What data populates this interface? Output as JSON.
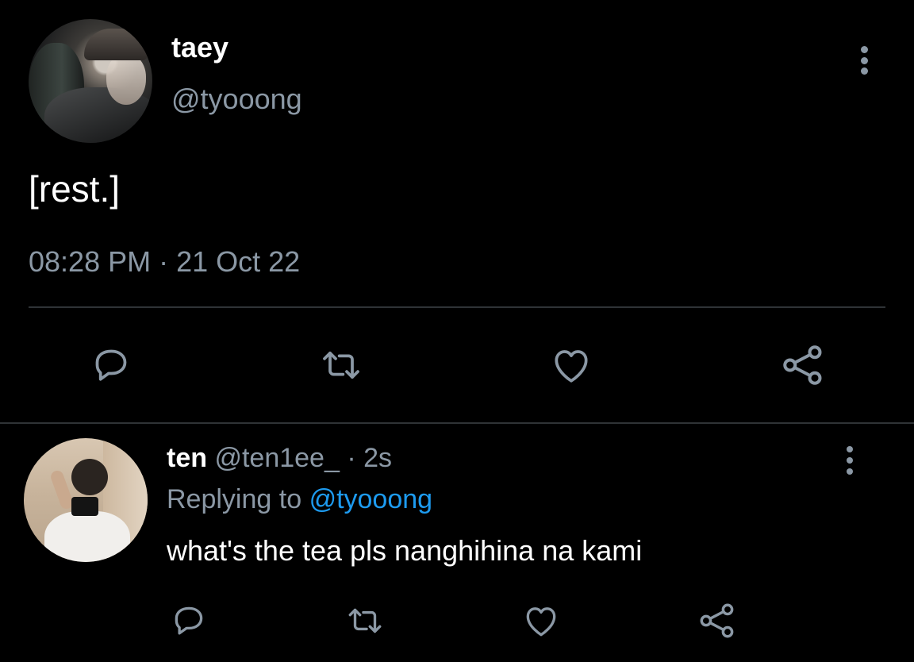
{
  "main_tweet": {
    "display_name": "taey",
    "handle": "@tyooong",
    "text": "[rest.]",
    "time": "08:28 PM",
    "separator": "·",
    "date": "21 Oct 22",
    "more_icon": "more-vertical-icon",
    "actions": [
      {
        "name": "reply",
        "icon": "reply-icon"
      },
      {
        "name": "retweet",
        "icon": "retweet-icon"
      },
      {
        "name": "like",
        "icon": "heart-icon"
      },
      {
        "name": "share",
        "icon": "share-icon"
      }
    ]
  },
  "reply_tweet": {
    "display_name": "ten",
    "handle": "@ten1ee_",
    "separator": "·",
    "time": "2s",
    "replying_prefix": "Replying to",
    "replying_to": "@tyooong",
    "text": "what's the tea pls nanghihina na kami",
    "more_icon": "more-vertical-icon",
    "actions": [
      {
        "name": "reply",
        "icon": "reply-icon"
      },
      {
        "name": "retweet",
        "icon": "retweet-icon"
      },
      {
        "name": "like",
        "icon": "heart-icon"
      },
      {
        "name": "share",
        "icon": "share-icon"
      }
    ]
  },
  "colors": {
    "background": "#000000",
    "primary_text": "#ffffff",
    "secondary_text": "#8b98a5",
    "accent": "#1d9bf0",
    "divider": "#2f3336"
  }
}
